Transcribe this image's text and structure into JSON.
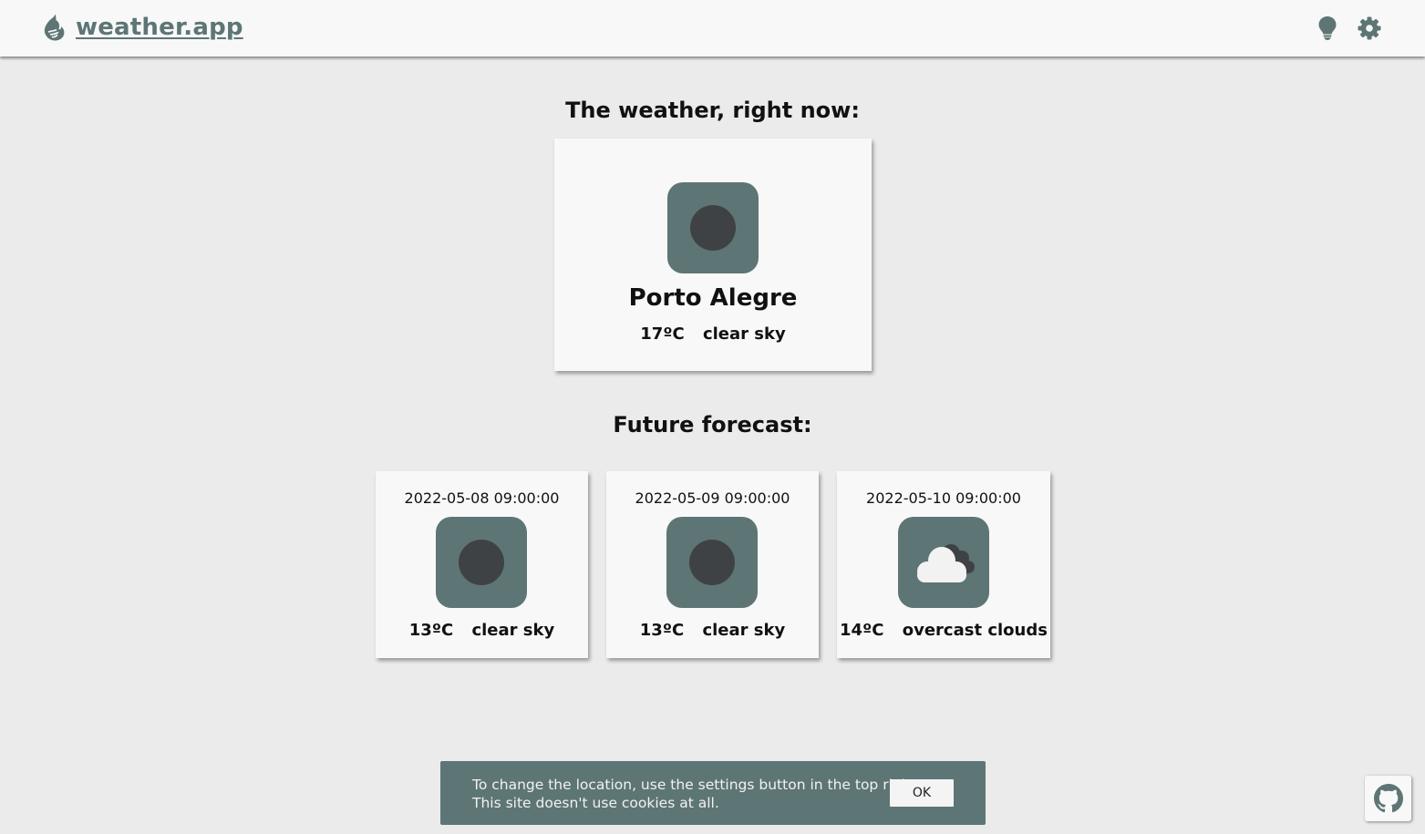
{
  "header": {
    "brand_name": "weather.app",
    "brand_icon": "flame-wind-icon",
    "actions": [
      "lightbulb-icon",
      "gear-icon"
    ]
  },
  "now": {
    "title": "The weather, right now:",
    "city": "Porto Alegre",
    "temperature": "17ºC",
    "description": "clear sky",
    "icon": "clear-sky-icon"
  },
  "forecast": {
    "title": "Future forecast:",
    "items": [
      {
        "datetime": "2022-05-08 09:00:00",
        "temperature": "13ºC",
        "description": "clear sky",
        "icon": "clear-sky-icon"
      },
      {
        "datetime": "2022-05-09 09:00:00",
        "temperature": "13ºC",
        "description": "clear sky",
        "icon": "clear-sky-icon"
      },
      {
        "datetime": "2022-05-10 09:00:00",
        "temperature": "14ºC",
        "description": "overcast clouds",
        "icon": "overcast-clouds-icon"
      }
    ]
  },
  "notice": {
    "line1": "To change the location, use the settings button in the top right.",
    "line2": "This site doesn't use cookies at all.",
    "ok_label": "OK"
  },
  "footer": {
    "github_icon": "github-icon"
  },
  "colors": {
    "accent": "#5e7575",
    "background": "#ebebeb",
    "card": "#f8f8f8",
    "sun": "#3f4244"
  }
}
